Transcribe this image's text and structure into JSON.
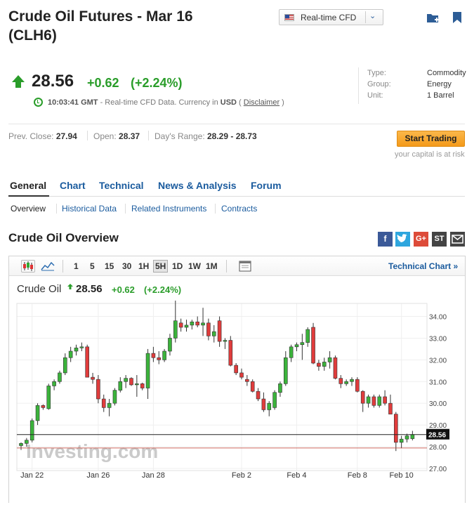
{
  "header": {
    "title_line1": "Crude Oil Futures - Mar 16",
    "title_line2": "(CLH6)",
    "cfd_select": "Real-time CFD"
  },
  "quote": {
    "price": "28.56",
    "change": "+0.62",
    "change_pct": "(+2.24%)",
    "time": "10:03:41 GMT",
    "time_note": " - Real-time CFD Data. Currency in ",
    "currency": "USD",
    "paren_open": " ( ",
    "disclaimer": "Disclaimer",
    "paren_close": " )"
  },
  "info": [
    {
      "key": "Type:",
      "value": "Commodity"
    },
    {
      "key": "Group:",
      "value": "Energy"
    },
    {
      "key": "Unit:",
      "value": "1 Barrel"
    }
  ],
  "stats": {
    "prev_close_label": "Prev. Close: ",
    "prev_close": "27.94",
    "open_label": "Open: ",
    "open": "28.37",
    "range_label": "Day's Range: ",
    "range": "28.29 - 28.73"
  },
  "cta": {
    "start_trading": "Start Trading",
    "risk": "your capital is at risk"
  },
  "tabs": [
    "General",
    "Chart",
    "Technical",
    "News & Analysis",
    "Forum"
  ],
  "subtabs": [
    "Overview",
    "Historical Data",
    "Related Instruments",
    "Contracts"
  ],
  "section_title": "Crude Oil Overview",
  "share": [
    "f",
    "t",
    "G+",
    "ST",
    "mail"
  ],
  "toolbar": {
    "intervals": [
      "1",
      "5",
      "15",
      "30",
      "1H",
      "5H",
      "1D",
      "1W",
      "1M"
    ],
    "active_interval": "5H",
    "tech_chart": "Technical Chart »"
  },
  "legend": {
    "name": "Crude Oil",
    "price": "28.56",
    "change": "+0.62",
    "change_pct": "(+2.24%)"
  },
  "chart_data": {
    "type": "candlestick",
    "ylim": [
      26.9,
      34.6
    ],
    "yticks": [
      "34.00",
      "33.00",
      "32.00",
      "31.00",
      "30.00",
      "29.00",
      "28.00",
      "27.00"
    ],
    "xlabels": [
      "Jan 22",
      "Jan 26",
      "Jan 28",
      "Feb 2",
      "Feb 4",
      "Feb 8",
      "Feb 10"
    ],
    "last_price": "28.56",
    "prev_close_line": 27.94,
    "watermark": "Investing.com",
    "up_color": "#3bb33b",
    "down_color": "#e03c3c",
    "candles": [
      [
        28.05,
        28.2,
        27.85,
        28.15
      ],
      [
        28.15,
        28.4,
        28.0,
        28.3
      ],
      [
        28.3,
        29.3,
        28.2,
        29.2
      ],
      [
        29.2,
        30.0,
        29.0,
        29.9
      ],
      [
        29.9,
        29.95,
        29.7,
        29.8
      ],
      [
        29.75,
        30.9,
        29.7,
        30.8
      ],
      [
        30.8,
        31.1,
        30.6,
        31.0
      ],
      [
        31.0,
        31.5,
        30.9,
        31.4
      ],
      [
        31.4,
        32.3,
        31.3,
        32.1
      ],
      [
        32.1,
        32.6,
        31.9,
        32.4
      ],
      [
        32.4,
        32.7,
        32.2,
        32.55
      ],
      [
        32.55,
        32.8,
        32.4,
        32.6
      ],
      [
        32.6,
        32.7,
        31.3,
        31.2
      ],
      [
        31.2,
        31.4,
        30.9,
        31.1
      ],
      [
        31.1,
        31.3,
        30.0,
        30.2
      ],
      [
        30.2,
        30.4,
        29.6,
        29.8
      ],
      [
        29.8,
        30.2,
        29.4,
        30.0
      ],
      [
        30.0,
        30.7,
        29.9,
        30.6
      ],
      [
        30.6,
        31.2,
        30.5,
        31.0
      ],
      [
        31.0,
        31.3,
        30.7,
        31.15
      ],
      [
        31.15,
        31.2,
        30.8,
        30.85
      ],
      [
        30.85,
        31.3,
        30.3,
        30.9
      ],
      [
        30.9,
        30.95,
        30.6,
        30.7
      ],
      [
        30.7,
        32.5,
        30.2,
        32.3
      ],
      [
        32.3,
        32.6,
        31.9,
        32.1
      ],
      [
        32.1,
        32.4,
        31.8,
        32.0
      ],
      [
        32.0,
        32.5,
        31.9,
        32.4
      ],
      [
        32.4,
        33.2,
        32.2,
        33.0
      ],
      [
        33.0,
        34.8,
        32.8,
        33.8
      ],
      [
        33.7,
        33.9,
        33.3,
        33.5
      ],
      [
        33.5,
        33.85,
        33.3,
        33.6
      ],
      [
        33.6,
        33.85,
        33.4,
        33.75
      ],
      [
        33.75,
        34.0,
        33.5,
        33.6
      ],
      [
        33.6,
        34.4,
        33.1,
        33.7
      ],
      [
        33.7,
        33.9,
        32.9,
        33.1
      ],
      [
        33.1,
        33.6,
        32.8,
        33.3
      ],
      [
        33.8,
        34.0,
        32.6,
        32.85
      ],
      [
        32.85,
        33.0,
        32.5,
        32.9
      ],
      [
        32.9,
        33.1,
        31.7,
        31.75
      ],
      [
        31.75,
        31.85,
        31.3,
        31.4
      ],
      [
        31.4,
        31.6,
        31.1,
        31.2
      ],
      [
        31.1,
        31.3,
        30.8,
        31.0
      ],
      [
        31.0,
        31.1,
        30.5,
        30.55
      ],
      [
        30.55,
        30.7,
        30.1,
        30.2
      ],
      [
        30.2,
        30.5,
        29.6,
        29.7
      ],
      [
        29.7,
        30.1,
        29.4,
        30.0
      ],
      [
        29.8,
        30.6,
        29.7,
        30.5
      ],
      [
        30.5,
        31.0,
        30.3,
        30.9
      ],
      [
        30.9,
        32.4,
        30.8,
        32.1
      ],
      [
        32.1,
        32.7,
        31.9,
        32.6
      ],
      [
        32.6,
        32.8,
        32.4,
        32.7
      ],
      [
        32.7,
        33.2,
        32.0,
        32.8
      ],
      [
        32.8,
        33.5,
        32.6,
        33.4
      ],
      [
        33.5,
        33.7,
        31.8,
        31.85
      ],
      [
        31.85,
        32.0,
        31.5,
        31.7
      ],
      [
        31.7,
        32.1,
        31.5,
        31.9
      ],
      [
        31.9,
        32.4,
        31.6,
        32.1
      ],
      [
        32.1,
        32.2,
        31.1,
        31.15
      ],
      [
        31.15,
        31.3,
        30.7,
        30.9
      ],
      [
        30.9,
        31.1,
        30.8,
        31.0
      ],
      [
        31.0,
        31.2,
        30.8,
        31.1
      ],
      [
        31.1,
        31.2,
        30.5,
        30.55
      ],
      [
        30.55,
        30.6,
        29.6,
        30.0
      ],
      [
        30.0,
        30.4,
        29.8,
        30.3
      ],
      [
        30.3,
        30.4,
        29.8,
        29.9
      ],
      [
        29.9,
        30.4,
        29.8,
        30.3
      ],
      [
        30.3,
        30.6,
        29.9,
        30.0
      ],
      [
        30.0,
        30.4,
        29.6,
        29.5
      ],
      [
        29.5,
        29.6,
        27.8,
        28.2
      ],
      [
        28.2,
        28.5,
        27.95,
        28.35
      ],
      [
        28.35,
        28.6,
        28.2,
        28.5
      ],
      [
        28.37,
        28.73,
        28.29,
        28.56
      ]
    ]
  }
}
